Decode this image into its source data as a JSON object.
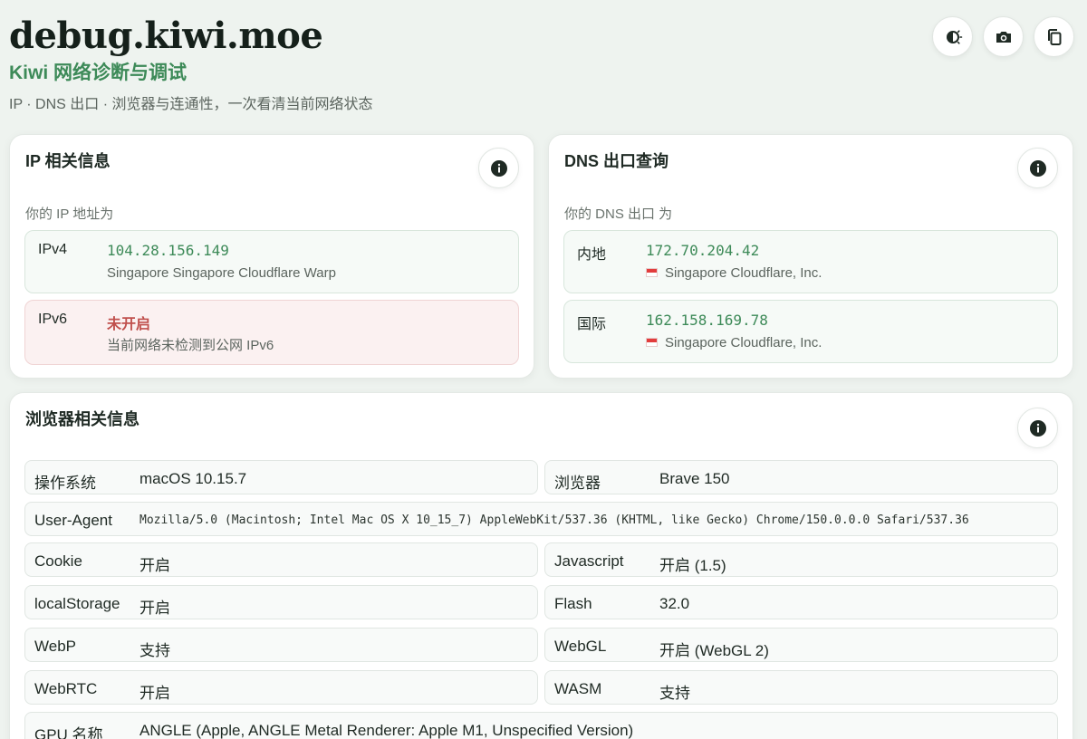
{
  "header": {
    "site_title": "debug.kiwi.moe",
    "subtitle": "Kiwi 网络诊断与调试",
    "tagline": "IP · DNS 出口 · 浏览器与连通性，一次看清当前网络状态",
    "buttons": [
      {
        "icon": "theme-toggle-icon"
      },
      {
        "icon": "camera-icon"
      },
      {
        "icon": "copy-icon"
      }
    ]
  },
  "ip_card": {
    "title": "IP 相关信息",
    "label": "你的 IP 地址为",
    "ipv4": {
      "key": "IPv4",
      "value": "104.28.156.149",
      "location": "Singapore Singapore Cloudflare Warp"
    },
    "ipv6": {
      "key": "IPv6",
      "value": "未开启",
      "note": "当前网络未检测到公网 IPv6"
    }
  },
  "dns_card": {
    "title": "DNS 出口查询",
    "label": "你的 DNS 出口 为",
    "domestic": {
      "key": "内地",
      "value": "172.70.204.42",
      "location": "Singapore Cloudflare, Inc."
    },
    "international": {
      "key": "国际",
      "value": "162.158.169.78",
      "location": "Singapore Cloudflare, Inc."
    }
  },
  "browser_card": {
    "title": "浏览器相关信息",
    "os": {
      "key": "操作系统",
      "value": "macOS 10.15.7"
    },
    "browser": {
      "key": "浏览器",
      "value": "Brave 150"
    },
    "user_agent": {
      "key": "User-Agent",
      "value": "Mozilla/5.0 (Macintosh; Intel Mac OS X 10_15_7) AppleWebKit/537.36 (KHTML, like Gecko) Chrome/150.0.0.0 Safari/537.36"
    },
    "cookie": {
      "key": "Cookie",
      "value": "开启"
    },
    "javascript": {
      "key": "Javascript",
      "value": "开启 (1.5)"
    },
    "local_storage": {
      "key": "localStorage",
      "value": "开启"
    },
    "flash": {
      "key": "Flash",
      "value": "32.0"
    },
    "webp": {
      "key": "WebP",
      "value": "支持"
    },
    "webgl": {
      "key": "WebGL",
      "value": "开启 (WebGL 2)"
    },
    "webrtc": {
      "key": "WebRTC",
      "value": "开启"
    },
    "wasm": {
      "key": "WASM",
      "value": "支持"
    },
    "gpu": {
      "key": "GPU 名称",
      "value": "ANGLE (Apple, ANGLE Metal Renderer: Apple M1, Unspecified Version)"
    }
  },
  "colors": {
    "accent_green": "#3d8a58",
    "warn_red": "#c0504d",
    "background": "#eef3ef"
  }
}
